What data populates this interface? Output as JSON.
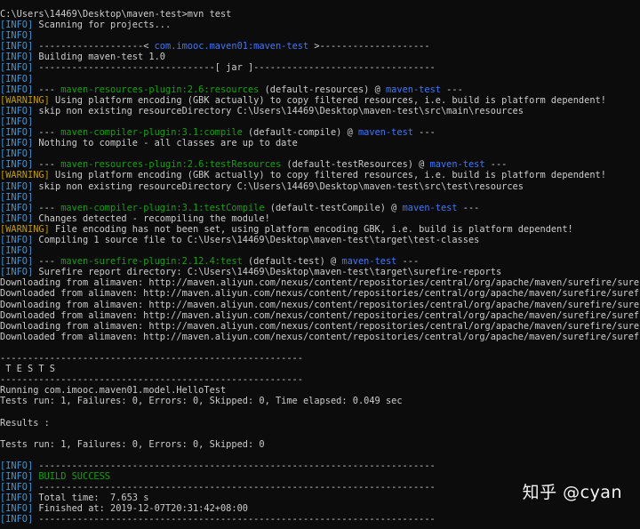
{
  "watermark": "知乎 @cyan",
  "colors": {
    "info": "#3a96dd",
    "warning": "#c19c00",
    "text": "#cccccc",
    "green": "#13a10e",
    "blue": "#3b78ff",
    "background": "#0c0c0c"
  },
  "lines": [
    [
      {
        "t": "C:\\Users\\14469\\Desktop\\maven-test>mvn test",
        "c": "text"
      }
    ],
    [
      {
        "t": "[INFO]",
        "c": "info"
      },
      {
        "t": " Scanning for projects...",
        "c": "text"
      }
    ],
    [
      {
        "t": "[INFO]",
        "c": "info"
      }
    ],
    [
      {
        "t": "[INFO]",
        "c": "info"
      },
      {
        "t": " -------------------< ",
        "c": "text"
      },
      {
        "t": "com.imooc.maven01:maven-test",
        "c": "blue"
      },
      {
        "t": " >--------------------",
        "c": "text"
      }
    ],
    [
      {
        "t": "[INFO]",
        "c": "info"
      },
      {
        "t": " Building maven-test 1.0",
        "c": "text"
      }
    ],
    [
      {
        "t": "[INFO]",
        "c": "info"
      },
      {
        "t": " --------------------------------[ jar ]---------------------------------",
        "c": "text"
      }
    ],
    [
      {
        "t": "[INFO]",
        "c": "info"
      }
    ],
    [
      {
        "t": "[INFO]",
        "c": "info"
      },
      {
        "t": " --- ",
        "c": "text"
      },
      {
        "t": "maven-resources-plugin:2.6:resources",
        "c": "green"
      },
      {
        "t": " (default-resources) @ ",
        "c": "text"
      },
      {
        "t": "maven-test",
        "c": "blue"
      },
      {
        "t": " ---",
        "c": "text"
      }
    ],
    [
      {
        "t": "[WARNING]",
        "c": "warn"
      },
      {
        "t": " Using platform encoding (GBK actually) to copy filtered resources, i.e. build is platform dependent!",
        "c": "text"
      }
    ],
    [
      {
        "t": "[INFO]",
        "c": "info"
      },
      {
        "t": " skip non existing resourceDirectory C:\\Users\\14469\\Desktop\\maven-test\\src\\main\\resources",
        "c": "text"
      }
    ],
    [
      {
        "t": "[INFO]",
        "c": "info"
      }
    ],
    [
      {
        "t": "[INFO]",
        "c": "info"
      },
      {
        "t": " --- ",
        "c": "text"
      },
      {
        "t": "maven-compiler-plugin:3.1:compile",
        "c": "green"
      },
      {
        "t": " (default-compile) @ ",
        "c": "text"
      },
      {
        "t": "maven-test",
        "c": "blue"
      },
      {
        "t": " ---",
        "c": "text"
      }
    ],
    [
      {
        "t": "[INFO]",
        "c": "info"
      },
      {
        "t": " Nothing to compile - all classes are up to date",
        "c": "text"
      }
    ],
    [
      {
        "t": "[INFO]",
        "c": "info"
      }
    ],
    [
      {
        "t": "[INFO]",
        "c": "info"
      },
      {
        "t": " --- ",
        "c": "text"
      },
      {
        "t": "maven-resources-plugin:2.6:testResources",
        "c": "green"
      },
      {
        "t": " (default-testResources) @ ",
        "c": "text"
      },
      {
        "t": "maven-test",
        "c": "blue"
      },
      {
        "t": " ---",
        "c": "text"
      }
    ],
    [
      {
        "t": "[WARNING]",
        "c": "warn"
      },
      {
        "t": " Using platform encoding (GBK actually) to copy filtered resources, i.e. build is platform dependent!",
        "c": "text"
      }
    ],
    [
      {
        "t": "[INFO]",
        "c": "info"
      },
      {
        "t": " skip non existing resourceDirectory C:\\Users\\14469\\Desktop\\maven-test\\src\\test\\resources",
        "c": "text"
      }
    ],
    [
      {
        "t": "[INFO]",
        "c": "info"
      }
    ],
    [
      {
        "t": "[INFO]",
        "c": "info"
      },
      {
        "t": " --- ",
        "c": "text"
      },
      {
        "t": "maven-compiler-plugin:3.1:testCompile",
        "c": "green"
      },
      {
        "t": " (default-testCompile) @ ",
        "c": "text"
      },
      {
        "t": "maven-test",
        "c": "blue"
      },
      {
        "t": " ---",
        "c": "text"
      }
    ],
    [
      {
        "t": "[INFO]",
        "c": "info"
      },
      {
        "t": " Changes detected - recompiling the module!",
        "c": "text"
      }
    ],
    [
      {
        "t": "[WARNING]",
        "c": "warn"
      },
      {
        "t": " File encoding has not been set, using platform encoding GBK, i.e. build is platform dependent!",
        "c": "text"
      }
    ],
    [
      {
        "t": "[INFO]",
        "c": "info"
      },
      {
        "t": " Compiling 1 source file to C:\\Users\\14469\\Desktop\\maven-test\\target\\test-classes",
        "c": "text"
      }
    ],
    [
      {
        "t": "[INFO]",
        "c": "info"
      }
    ],
    [
      {
        "t": "[INFO]",
        "c": "info"
      },
      {
        "t": " --- ",
        "c": "text"
      },
      {
        "t": "maven-surefire-plugin:2.12.4:test",
        "c": "green"
      },
      {
        "t": " (default-test) @ ",
        "c": "text"
      },
      {
        "t": "maven-test",
        "c": "blue"
      },
      {
        "t": " ---",
        "c": "text"
      }
    ],
    [
      {
        "t": "[INFO]",
        "c": "info"
      },
      {
        "t": " Surefire report directory: C:\\Users\\14469\\Desktop\\maven-test\\target\\surefire-reports",
        "c": "text"
      }
    ],
    [
      {
        "t": "Downloading from alimaven: http://maven.aliyun.com/nexus/content/repositories/central/org/apache/maven/surefire/surefire",
        "c": "text"
      }
    ],
    [
      {
        "t": "Downloaded from alimaven: http://maven.aliyun.com/nexus/content/repositories/central/org/apache/maven/surefire/surefire",
        "c": "text"
      }
    ],
    [
      {
        "t": "Downloading from alimaven: http://maven.aliyun.com/nexus/content/repositories/central/org/apache/maven/surefire/surefire",
        "c": "text"
      }
    ],
    [
      {
        "t": "Downloaded from alimaven: http://maven.aliyun.com/nexus/content/repositories/central/org/apache/maven/surefire/surefire",
        "c": "text"
      }
    ],
    [
      {
        "t": "Downloading from alimaven: http://maven.aliyun.com/nexus/content/repositories/central/org/apache/maven/surefire/surefire",
        "c": "text"
      }
    ],
    [
      {
        "t": "Downloaded from alimaven: http://maven.aliyun.com/nexus/content/repositories/central/org/apache/maven/surefire/surefire",
        "c": "text"
      }
    ],
    [],
    [
      {
        "t": "-------------------------------------------------------",
        "c": "text"
      }
    ],
    [
      {
        "t": " T E S T S",
        "c": "text"
      }
    ],
    [
      {
        "t": "-------------------------------------------------------",
        "c": "text"
      }
    ],
    [
      {
        "t": "Running com.imooc.maven01.model.HelloTest",
        "c": "text"
      }
    ],
    [
      {
        "t": "Tests run: 1, Failures: 0, Errors: 0, Skipped: 0, Time elapsed: 0.049 sec",
        "c": "text"
      }
    ],
    [],
    [
      {
        "t": "Results :",
        "c": "text"
      }
    ],
    [],
    [
      {
        "t": "Tests run: 1, Failures: 0, Errors: 0, Skipped: 0",
        "c": "text"
      }
    ],
    [],
    [
      {
        "t": "[INFO]",
        "c": "info"
      },
      {
        "t": " ------------------------------------------------------------------------",
        "c": "text"
      }
    ],
    [
      {
        "t": "[INFO]",
        "c": "info"
      },
      {
        "t": " ",
        "c": "text"
      },
      {
        "t": "BUILD SUCCESS",
        "c": "green"
      }
    ],
    [
      {
        "t": "[INFO]",
        "c": "info"
      },
      {
        "t": " ------------------------------------------------------------------------",
        "c": "text"
      }
    ],
    [
      {
        "t": "[INFO]",
        "c": "info"
      },
      {
        "t": " Total time:  7.653 s",
        "c": "text"
      }
    ],
    [
      {
        "t": "[INFO]",
        "c": "info"
      },
      {
        "t": " Finished at: 2019-12-07T20:31:42+08:00",
        "c": "text"
      }
    ],
    [
      {
        "t": "[INFO]",
        "c": "info"
      },
      {
        "t": " ------------------------------------------------------------------------",
        "c": "text"
      }
    ]
  ]
}
